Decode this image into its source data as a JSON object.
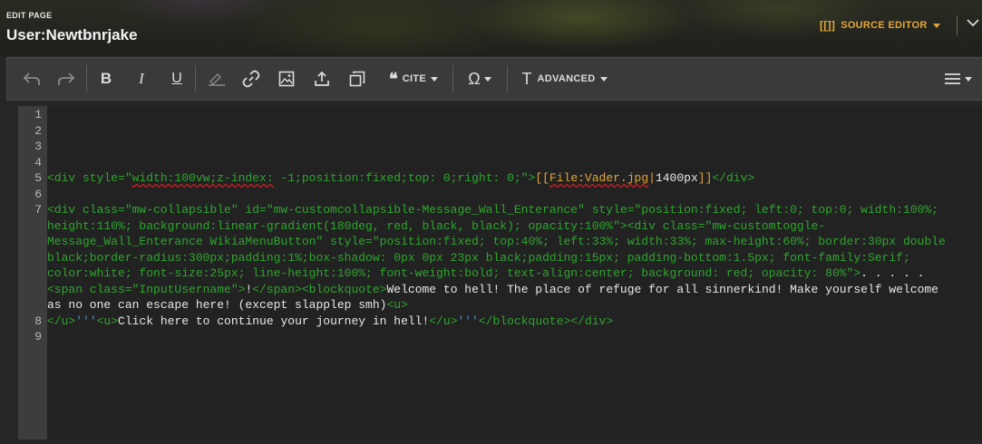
{
  "header": {
    "edit_label": "EDIT PAGE",
    "title": "User:Newtbnrjake",
    "mode_icon": "[[]]",
    "mode_label": "SOURCE EDITOR"
  },
  "toolbar": {
    "undo": "undo-icon",
    "redo": "redo-icon",
    "bold": "B",
    "italic": "I",
    "underline": "U",
    "cite_label": "CITE",
    "special_char": "Ω",
    "advanced_label": "ADVANCED",
    "advanced_icon": "T"
  },
  "editor": {
    "line_numbers": [
      "1",
      "2",
      "3",
      "4",
      "5",
      "6",
      "7",
      "8",
      "9"
    ],
    "lines": {
      "l5": {
        "open_a": "<div style=\"",
        "style_sq": "width:100vw;z-index:",
        "style_rest": " -1;position:fixed;top: 0;right: 0;\">",
        "link_open": "[[",
        "file": "File:Vader.jpg",
        "pipe": "|",
        "size": "1400px",
        "link_close": "]]",
        "close": "</div>"
      },
      "l7": {
        "a": "<div class=\"mw-collapsible\" id=\"mw-customcollapsible-Message_Wall_Enterance\" style=\"position:fixed; left:0; top:0; width:100%;",
        "b": "height:110%; background:linear-gradient(180deg, red, black, black); opacity:100%\"><div class=\"mw-customtoggle-",
        "c": "Message_Wall_Enterance WikiaMenuButton\" style=\"position:fixed; top:40%; left:33%; width:33%; max-height:60%; border:30px double",
        "d": "black;border-radius:300px;padding:1%;box-shadow: 0px 0px 23px black;padding:15px; padding-bottom:1.5px; font-family:Serif;",
        "e1": "color:white; font-size:25px; line-height:100%; font-weight:bold; text-align:center; background: red; opacity: 80%\">",
        "e2": ". . . . .",
        "f1": "<span class=\"InputUsername\">",
        "f2": "!",
        "f3": "</span><blockquote>",
        "f4": "Welcome to hell! The place of refuge for all sinnerkind! Make yourself welcome",
        "g1": "as no one can escape here! (except slapplep smh)",
        "g2": "<u>"
      },
      "l8": {
        "a": "</u>",
        "b": "'''",
        "c": "<u>",
        "d": "Click here to continue your journey in hell!",
        "e": "</u>",
        "f": "'''",
        "g": "</blockquote></div>"
      }
    }
  },
  "colors": {
    "accent": "#e3a63a",
    "tag": "#2fa52f",
    "link": "#e3a63a",
    "bold_marker": "#4a8fd4",
    "gutter": "#3d3d3d",
    "editor_bg": "#222222"
  }
}
